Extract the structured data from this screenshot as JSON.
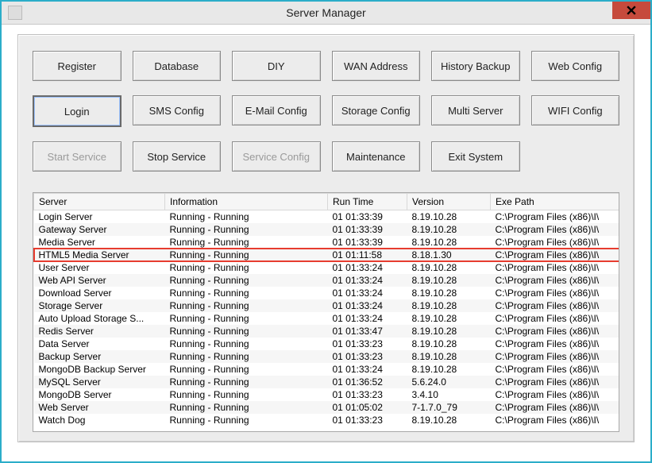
{
  "window": {
    "title": "Server Manager"
  },
  "buttons": [
    {
      "label": "Register",
      "state": "normal",
      "name": "register-button"
    },
    {
      "label": "Database",
      "state": "normal",
      "name": "database-button"
    },
    {
      "label": "DIY",
      "state": "normal",
      "name": "diy-button"
    },
    {
      "label": "WAN Address",
      "state": "normal",
      "name": "wan-address-button"
    },
    {
      "label": "History Backup",
      "state": "normal",
      "name": "history-backup-button"
    },
    {
      "label": "Web Config",
      "state": "normal",
      "name": "web-config-button"
    },
    {
      "label": "Login",
      "state": "selected",
      "name": "login-button"
    },
    {
      "label": "SMS Config",
      "state": "normal",
      "name": "sms-config-button"
    },
    {
      "label": "E-Mail Config",
      "state": "normal",
      "name": "email-config-button"
    },
    {
      "label": "Storage Config",
      "state": "normal",
      "name": "storage-config-button"
    },
    {
      "label": "Multi Server",
      "state": "normal",
      "name": "multi-server-button"
    },
    {
      "label": "WIFI Config",
      "state": "normal",
      "name": "wifi-config-button"
    },
    {
      "label": "Start Service",
      "state": "disabled",
      "name": "start-service-button"
    },
    {
      "label": "Stop Service",
      "state": "normal",
      "name": "stop-service-button"
    },
    {
      "label": "Service Config",
      "state": "disabled",
      "name": "service-config-button"
    },
    {
      "label": "Maintenance",
      "state": "normal",
      "name": "maintenance-button"
    },
    {
      "label": "Exit System",
      "state": "normal",
      "name": "exit-system-button"
    }
  ],
  "columns": [
    "Server",
    "Information",
    "Run Time",
    "Version",
    "Exe Path"
  ],
  "rows": [
    {
      "server": "Login Server",
      "info": "Running - Running",
      "runtime": "01 01:33:39",
      "version": "8.19.10.28",
      "path": "C:\\Program Files (x86)\\I\\"
    },
    {
      "server": "Gateway Server",
      "info": "Running - Running",
      "runtime": "01 01:33:39",
      "version": "8.19.10.28",
      "path": "C:\\Program Files (x86)\\I\\"
    },
    {
      "server": "Media Server",
      "info": "Running - Running",
      "runtime": "01 01:33:39",
      "version": "8.19.10.28",
      "path": "C:\\Program Files (x86)\\I\\"
    },
    {
      "server": "HTML5 Media Server",
      "info": "Running - Running",
      "runtime": "01 01:11:58",
      "version": "8.18.1.30",
      "path": "C:\\Program Files (x86)\\I\\",
      "highlight": true
    },
    {
      "server": "User Server",
      "info": "Running - Running",
      "runtime": "01 01:33:24",
      "version": "8.19.10.28",
      "path": "C:\\Program Files (x86)\\I\\"
    },
    {
      "server": "Web API Server",
      "info": "Running - Running",
      "runtime": "01 01:33:24",
      "version": "8.19.10.28",
      "path": "C:\\Program Files (x86)\\I\\"
    },
    {
      "server": "Download Server",
      "info": "Running - Running",
      "runtime": "01 01:33:24",
      "version": "8.19.10.28",
      "path": "C:\\Program Files (x86)\\I\\"
    },
    {
      "server": "Storage Server",
      "info": "Running - Running",
      "runtime": "01 01:33:24",
      "version": "8.19.10.28",
      "path": "C:\\Program Files (x86)\\I\\"
    },
    {
      "server": "Auto Upload Storage S...",
      "info": "Running - Running",
      "runtime": "01 01:33:24",
      "version": "8.19.10.28",
      "path": "C:\\Program Files (x86)\\I\\"
    },
    {
      "server": "Redis Server",
      "info": "Running - Running",
      "runtime": "01 01:33:47",
      "version": "8.19.10.28",
      "path": "C:\\Program Files (x86)\\I\\"
    },
    {
      "server": "Data Server",
      "info": "Running - Running",
      "runtime": "01 01:33:23",
      "version": "8.19.10.28",
      "path": "C:\\Program Files (x86)\\I\\"
    },
    {
      "server": "Backup Server",
      "info": "Running - Running",
      "runtime": "01 01:33:23",
      "version": "8.19.10.28",
      "path": "C:\\Program Files (x86)\\I\\"
    },
    {
      "server": "MongoDB Backup Server",
      "info": "Running - Running",
      "runtime": "01 01:33:24",
      "version": "8.19.10.28",
      "path": "C:\\Program Files (x86)\\I\\"
    },
    {
      "server": "MySQL Server",
      "info": "Running - Running",
      "runtime": "01 01:36:52",
      "version": "5.6.24.0",
      "path": "C:\\Program Files (x86)\\I\\"
    },
    {
      "server": "MongoDB Server",
      "info": "Running - Running",
      "runtime": "01 01:33:23",
      "version": "3.4.10",
      "path": "C:\\Program Files (x86)\\I\\"
    },
    {
      "server": "Web Server",
      "info": "Running - Running",
      "runtime": "01 01:05:02",
      "version": "7-1.7.0_79",
      "path": "C:\\Program Files (x86)\\I\\"
    },
    {
      "server": "Watch Dog",
      "info": "Running - Running",
      "runtime": "01 01:33:23",
      "version": "8.19.10.28",
      "path": "C:\\Program Files (x86)\\I\\"
    }
  ]
}
